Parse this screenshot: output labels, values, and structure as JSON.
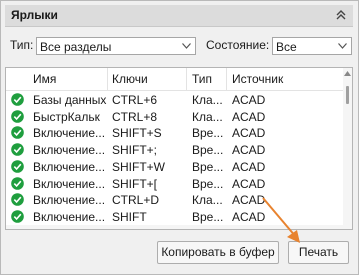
{
  "panel": {
    "title": "Ярлыки"
  },
  "filters": {
    "type_label": "Тип:",
    "type_value": "Все разделы",
    "state_label": "Состояние:",
    "state_value": "Все"
  },
  "table": {
    "columns": [
      "Имя",
      "Ключи",
      "Тип",
      "Источник"
    ],
    "rows": [
      [
        "Базы данных",
        "CTRL+6",
        "Кла...",
        "ACAD"
      ],
      [
        "БыстрКальк",
        "CTRL+8",
        "Кла...",
        "ACAD"
      ],
      [
        "Включение...",
        "SHIFT+S",
        "Вре...",
        "ACAD"
      ],
      [
        "Включение...",
        "SHIFT+;",
        "Вре...",
        "ACAD"
      ],
      [
        "Включение...",
        "SHIFT+W",
        "Вре...",
        "ACAD"
      ],
      [
        "Включение...",
        "SHIFT+[",
        "Вре...",
        "ACAD"
      ],
      [
        "Включение...",
        "CTRL+D",
        "Кла...",
        "ACAD"
      ],
      [
        "Включение...",
        "SHIFT",
        "Вре...",
        "ACAD"
      ]
    ]
  },
  "buttons": {
    "copy_label": "Копировать в буфер",
    "print_label": "Печать"
  },
  "colors": {
    "check_green": "#1f9e3e",
    "annotation_arrow": "#e8832f"
  },
  "icons": {
    "row_status": "check-circle-icon",
    "collapse": "double-chevron-up-icon"
  }
}
